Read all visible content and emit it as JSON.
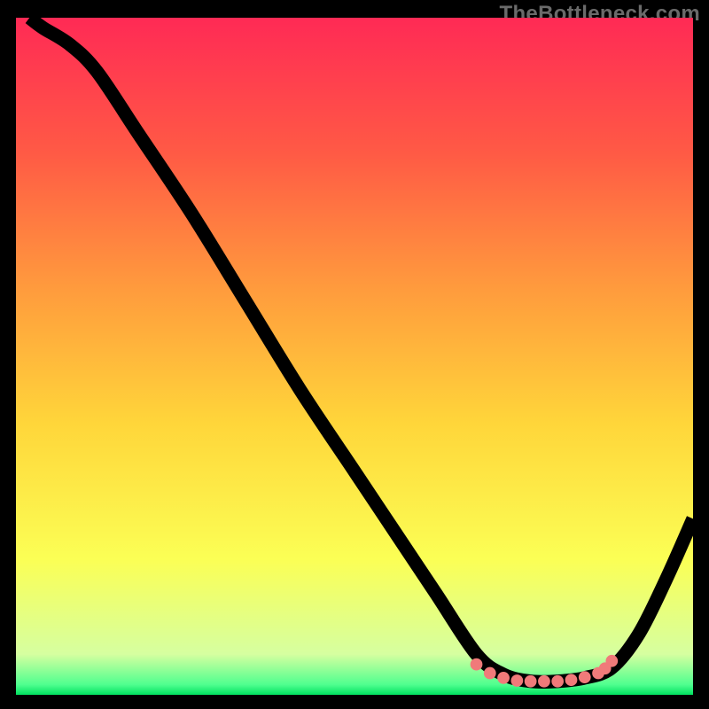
{
  "watermark": "TheBottleneck.com",
  "chart_data": {
    "type": "line",
    "title": "",
    "xlabel": "",
    "ylabel": "",
    "xlim": [
      0,
      100
    ],
    "ylim": [
      0,
      100
    ],
    "grid": false,
    "series": [
      {
        "name": "curve",
        "x": [
          2,
          4,
          8,
          12,
          18,
          26,
          34,
          42,
          50,
          56,
          62,
          68,
          72,
          76,
          80,
          84,
          88,
          92,
          96,
          100
        ],
        "y": [
          100,
          98.5,
          96,
          92,
          83,
          71,
          58,
          45,
          33,
          24,
          15,
          6,
          3,
          2,
          2,
          2.5,
          4,
          9,
          17,
          26
        ]
      }
    ],
    "highlight_points": {
      "name": "dots",
      "x": [
        68,
        70,
        72,
        74,
        76,
        78,
        80,
        82,
        84,
        86,
        87,
        88
      ],
      "y": [
        4.5,
        3.2,
        2.5,
        2.1,
        2.0,
        2.0,
        2.0,
        2.2,
        2.6,
        3.2,
        3.9,
        5.0
      ]
    },
    "background": {
      "type": "vertical-gradient",
      "stops": [
        {
          "offset": 0.0,
          "color": "#ff2a55"
        },
        {
          "offset": 0.2,
          "color": "#ff5a45"
        },
        {
          "offset": 0.4,
          "color": "#ff9b3d"
        },
        {
          "offset": 0.6,
          "color": "#ffd63a"
        },
        {
          "offset": 0.8,
          "color": "#fbff55"
        },
        {
          "offset": 0.94,
          "color": "#d6ffa0"
        },
        {
          "offset": 0.985,
          "color": "#4fff8f"
        },
        {
          "offset": 1.0,
          "color": "#00e060"
        }
      ]
    }
  }
}
